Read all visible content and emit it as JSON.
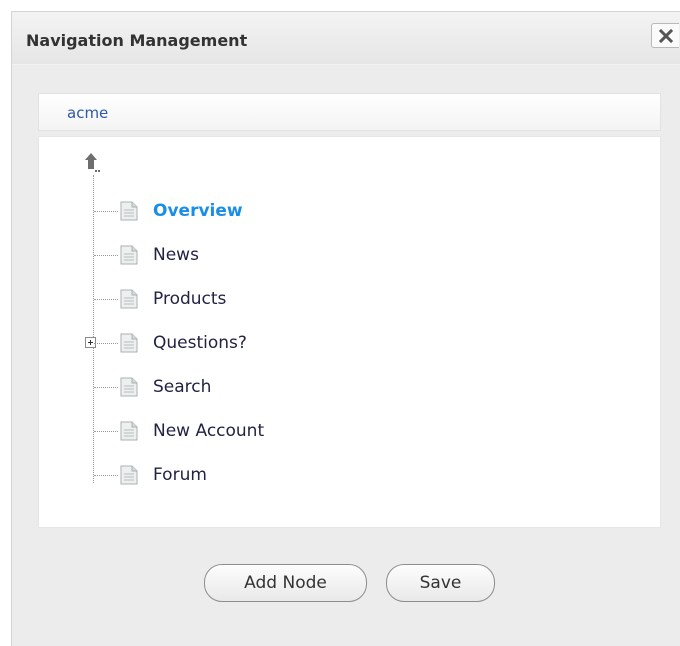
{
  "dialog": {
    "title": "Navigation Management",
    "close_icon": "close-icon"
  },
  "tree": {
    "root_label": "acme",
    "up_icon": "up-arrow-icon",
    "nodes": [
      {
        "label": "Overview",
        "active": true,
        "expandable": false
      },
      {
        "label": "News",
        "active": false,
        "expandable": false
      },
      {
        "label": "Products",
        "active": false,
        "expandable": false
      },
      {
        "label": "Questions?",
        "active": false,
        "expandable": true
      },
      {
        "label": "Search",
        "active": false,
        "expandable": false
      },
      {
        "label": "New Account",
        "active": false,
        "expandable": false
      },
      {
        "label": "Forum",
        "active": false,
        "expandable": false
      }
    ]
  },
  "buttons": {
    "add_node_label": "Add Node",
    "save_label": "Save"
  },
  "colors": {
    "active_node": "#1a8ee6",
    "root_link": "#2d5aa5"
  }
}
